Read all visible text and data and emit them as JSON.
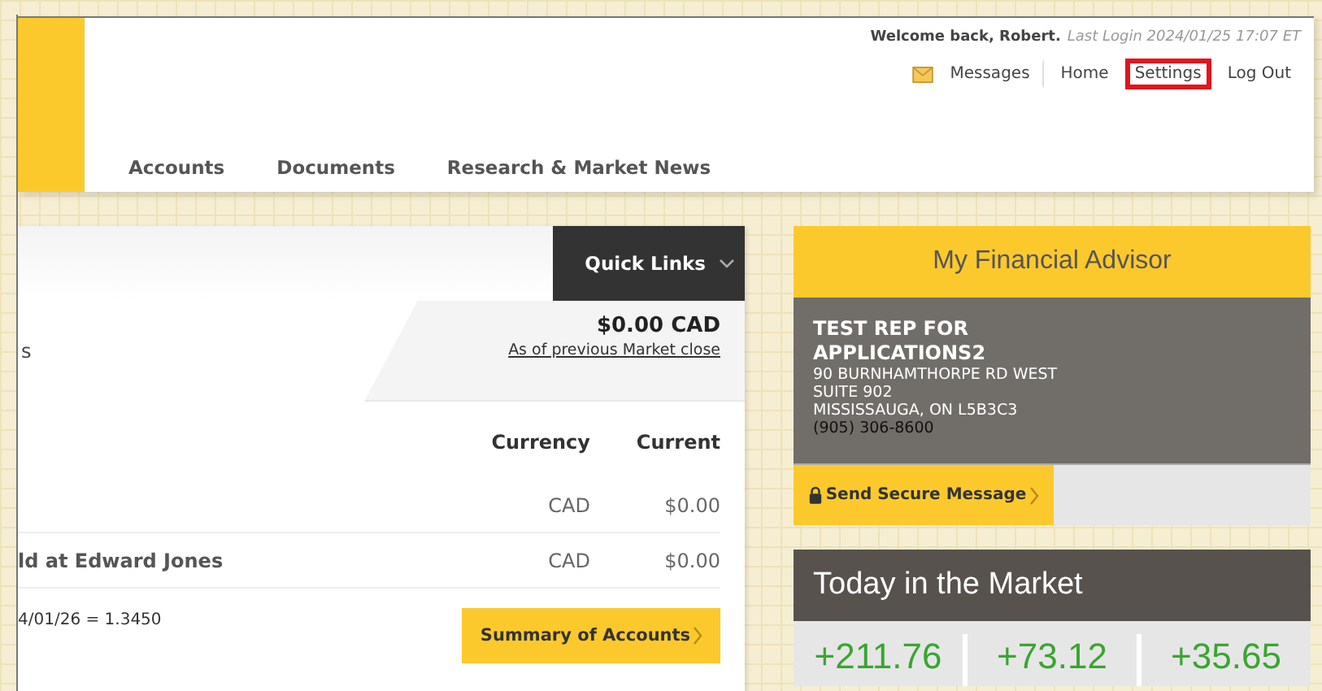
{
  "header": {
    "welcome": "Welcome back, Robert.",
    "last_login": "Last Login 2024/01/25 17:07 ET",
    "links": [
      {
        "label": "Messages",
        "kind": "mail",
        "selected": false
      },
      {
        "label": "Home",
        "kind": "plain",
        "selected": false
      },
      {
        "label": "Settings",
        "kind": "plain",
        "selected": true
      },
      {
        "label": "Log Out",
        "kind": "plain",
        "selected": false
      }
    ],
    "nav": [
      "Accounts",
      "Documents",
      "Research & Market News"
    ]
  },
  "accounts": {
    "quick_links": "Quick Links",
    "title_fragment": "s",
    "total": "$0.00 CAD",
    "total_note": "As of previous Market close",
    "columns": [
      "Currency",
      "Current"
    ],
    "rows": [
      {
        "name": "",
        "currency": "CAD",
        "value": "$0.00"
      },
      {
        "name": "ld at Edward Jones",
        "currency": "CAD",
        "value": "$0.00"
      }
    ],
    "rate": "4/01/26 = 1.3450",
    "summary_button": "Summary of Accounts"
  },
  "advisor": {
    "title": "My Financial Advisor",
    "name": "TEST REP FOR APPLICATIONS2",
    "address": [
      "90 BURNHAMTHORPE RD WEST",
      "SUITE 902",
      "MISSISSAUGA, ON L5B3C3"
    ],
    "phone": "(905) 306-8600",
    "message_button": "Send Secure Message"
  },
  "market": {
    "title": "Today in the Market",
    "values": [
      "+211.76",
      "+73.12",
      "+35.65"
    ]
  }
}
